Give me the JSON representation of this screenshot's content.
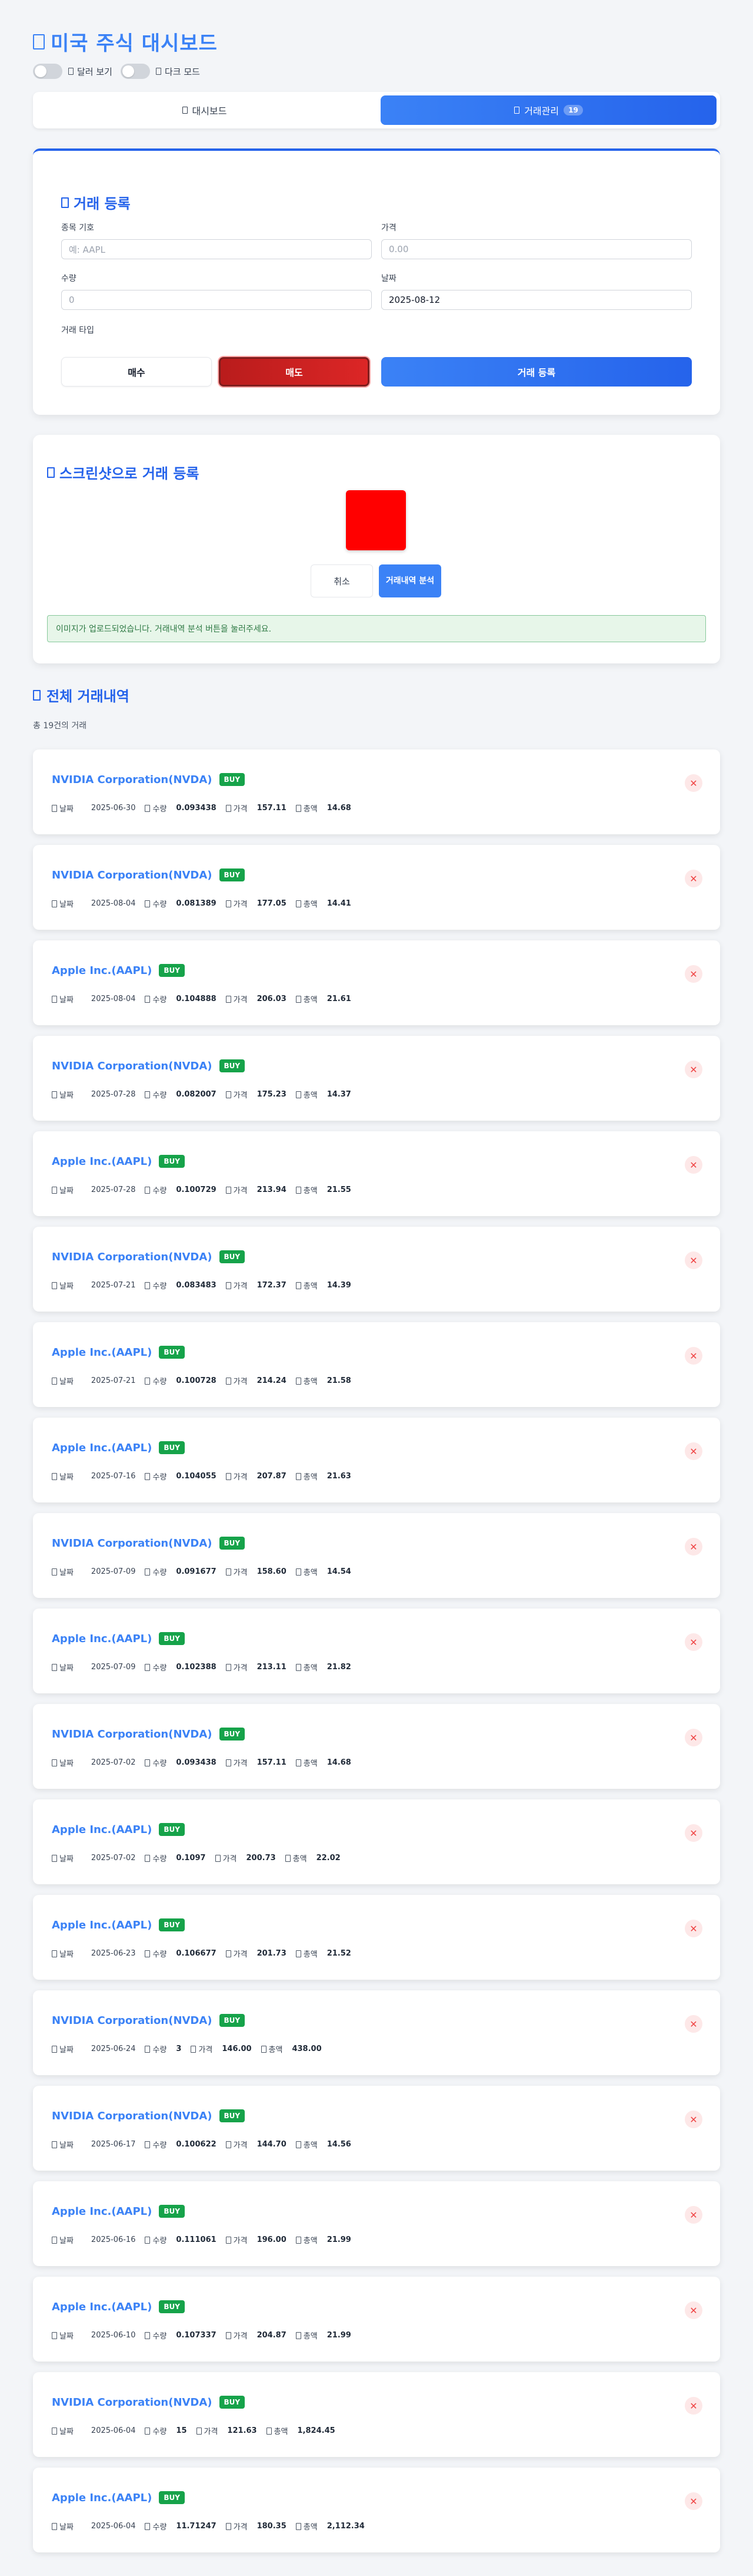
{
  "header": {
    "title": "미국 주식 대시보드",
    "toggle_dollar_label": "달러 보기",
    "toggle_dark_label": "다크 모드"
  },
  "tabs": [
    {
      "label": "대시보드",
      "active": false
    },
    {
      "label": "거래관리",
      "active": true,
      "badge": "19"
    }
  ],
  "trade_form": {
    "title": "거래 등록",
    "symbol_label": "종목 기호",
    "symbol_placeholder": "예: AAPL",
    "price_label": "가격",
    "price_placeholder": "0.00",
    "quantity_label": "수량",
    "quantity_placeholder": "0",
    "date_label": "날짜",
    "date_value": "2025-08-12",
    "type_label": "거래 타입",
    "buy_label": "매수",
    "sell_label": "매도",
    "selected_type": "매도",
    "submit_label": "거래 등록"
  },
  "screenshot_upload": {
    "title": "스크린샷으로 거래 등록",
    "preview_color": "#ff0000",
    "cancel_label": "취소",
    "analyze_label": "거래내역 분석",
    "success_message": "이미지가 업로드되었습니다. 거래내역 분석 버튼을 눌러주세요."
  },
  "history": {
    "title": "전체 거래내역",
    "count_text": "총 19건의 거래",
    "labels": {
      "date": "날짜",
      "qty": "수량",
      "price": "가격",
      "total": "총액"
    },
    "trades": [
      {
        "name": "NVIDIA Corporation(NVDA)",
        "type": "BUY",
        "date": "2025-06-30",
        "qty": "0.093438",
        "price": "157.11",
        "total": "14.68"
      },
      {
        "name": "NVIDIA Corporation(NVDA)",
        "type": "BUY",
        "date": "2025-08-04",
        "qty": "0.081389",
        "price": "177.05",
        "total": "14.41"
      },
      {
        "name": "Apple Inc.(AAPL)",
        "type": "BUY",
        "date": "2025-08-04",
        "qty": "0.104888",
        "price": "206.03",
        "total": "21.61"
      },
      {
        "name": "NVIDIA Corporation(NVDA)",
        "type": "BUY",
        "date": "2025-07-28",
        "qty": "0.082007",
        "price": "175.23",
        "total": "14.37"
      },
      {
        "name": "Apple Inc.(AAPL)",
        "type": "BUY",
        "date": "2025-07-28",
        "qty": "0.100729",
        "price": "213.94",
        "total": "21.55"
      },
      {
        "name": "NVIDIA Corporation(NVDA)",
        "type": "BUY",
        "date": "2025-07-21",
        "qty": "0.083483",
        "price": "172.37",
        "total": "14.39"
      },
      {
        "name": "Apple Inc.(AAPL)",
        "type": "BUY",
        "date": "2025-07-21",
        "qty": "0.100728",
        "price": "214.24",
        "total": "21.58"
      },
      {
        "name": "Apple Inc.(AAPL)",
        "type": "BUY",
        "date": "2025-07-16",
        "qty": "0.104055",
        "price": "207.87",
        "total": "21.63"
      },
      {
        "name": "NVIDIA Corporation(NVDA)",
        "type": "BUY",
        "date": "2025-07-09",
        "qty": "0.091677",
        "price": "158.60",
        "total": "14.54"
      },
      {
        "name": "Apple Inc.(AAPL)",
        "type": "BUY",
        "date": "2025-07-09",
        "qty": "0.102388",
        "price": "213.11",
        "total": "21.82"
      },
      {
        "name": "NVIDIA Corporation(NVDA)",
        "type": "BUY",
        "date": "2025-07-02",
        "qty": "0.093438",
        "price": "157.11",
        "total": "14.68"
      },
      {
        "name": "Apple Inc.(AAPL)",
        "type": "BUY",
        "date": "2025-07-02",
        "qty": "0.1097",
        "price": "200.73",
        "total": "22.02"
      },
      {
        "name": "Apple Inc.(AAPL)",
        "type": "BUY",
        "date": "2025-06-23",
        "qty": "0.106677",
        "price": "201.73",
        "total": "21.52"
      },
      {
        "name": "NVIDIA Corporation(NVDA)",
        "type": "BUY",
        "date": "2025-06-24",
        "qty": "3",
        "price": "146.00",
        "total": "438.00"
      },
      {
        "name": "NVIDIA Corporation(NVDA)",
        "type": "BUY",
        "date": "2025-06-17",
        "qty": "0.100622",
        "price": "144.70",
        "total": "14.56"
      },
      {
        "name": "Apple Inc.(AAPL)",
        "type": "BUY",
        "date": "2025-06-16",
        "qty": "0.111061",
        "price": "196.00",
        "total": "21.99"
      },
      {
        "name": "Apple Inc.(AAPL)",
        "type": "BUY",
        "date": "2025-06-10",
        "qty": "0.107337",
        "price": "204.87",
        "total": "21.99"
      },
      {
        "name": "NVIDIA Corporation(NVDA)",
        "type": "BUY",
        "date": "2025-06-04",
        "qty": "15",
        "price": "121.63",
        "total": "1,824.45"
      },
      {
        "name": "Apple Inc.(AAPL)",
        "type": "BUY",
        "date": "2025-06-04",
        "qty": "11.71247",
        "price": "180.35",
        "total": "2,112.34"
      }
    ]
  },
  "colors": {
    "accent": "#3b82f6",
    "buy_badge": "#16a34a",
    "sell_button": "#dc2626",
    "delete": "#ef4444"
  },
  "icons": {
    "delete": "close-icon",
    "section": "clipboard-icon"
  }
}
